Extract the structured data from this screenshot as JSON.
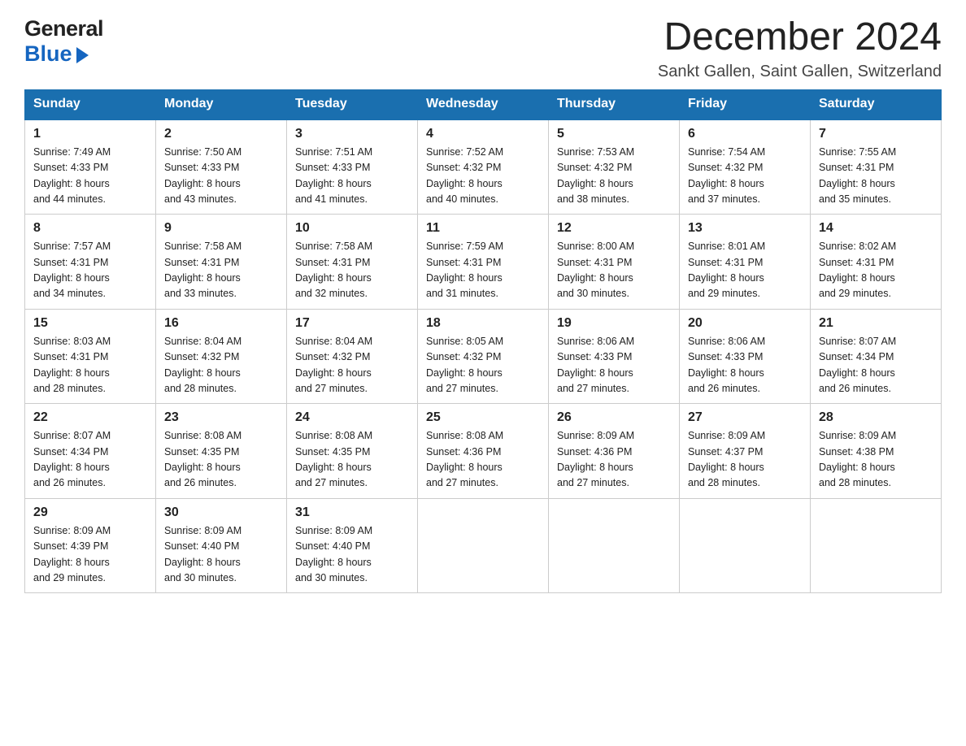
{
  "logo": {
    "general": "General",
    "blue": "Blue"
  },
  "header": {
    "month_title": "December 2024",
    "location": "Sankt Gallen, Saint Gallen, Switzerland"
  },
  "weekdays": [
    "Sunday",
    "Monday",
    "Tuesday",
    "Wednesday",
    "Thursday",
    "Friday",
    "Saturday"
  ],
  "weeks": [
    [
      {
        "day": "1",
        "sunrise": "7:49 AM",
        "sunset": "4:33 PM",
        "daylight": "8 hours and 44 minutes."
      },
      {
        "day": "2",
        "sunrise": "7:50 AM",
        "sunset": "4:33 PM",
        "daylight": "8 hours and 43 minutes."
      },
      {
        "day": "3",
        "sunrise": "7:51 AM",
        "sunset": "4:33 PM",
        "daylight": "8 hours and 41 minutes."
      },
      {
        "day": "4",
        "sunrise": "7:52 AM",
        "sunset": "4:32 PM",
        "daylight": "8 hours and 40 minutes."
      },
      {
        "day": "5",
        "sunrise": "7:53 AM",
        "sunset": "4:32 PM",
        "daylight": "8 hours and 38 minutes."
      },
      {
        "day": "6",
        "sunrise": "7:54 AM",
        "sunset": "4:32 PM",
        "daylight": "8 hours and 37 minutes."
      },
      {
        "day": "7",
        "sunrise": "7:55 AM",
        "sunset": "4:31 PM",
        "daylight": "8 hours and 35 minutes."
      }
    ],
    [
      {
        "day": "8",
        "sunrise": "7:57 AM",
        "sunset": "4:31 PM",
        "daylight": "8 hours and 34 minutes."
      },
      {
        "day": "9",
        "sunrise": "7:58 AM",
        "sunset": "4:31 PM",
        "daylight": "8 hours and 33 minutes."
      },
      {
        "day": "10",
        "sunrise": "7:58 AM",
        "sunset": "4:31 PM",
        "daylight": "8 hours and 32 minutes."
      },
      {
        "day": "11",
        "sunrise": "7:59 AM",
        "sunset": "4:31 PM",
        "daylight": "8 hours and 31 minutes."
      },
      {
        "day": "12",
        "sunrise": "8:00 AM",
        "sunset": "4:31 PM",
        "daylight": "8 hours and 30 minutes."
      },
      {
        "day": "13",
        "sunrise": "8:01 AM",
        "sunset": "4:31 PM",
        "daylight": "8 hours and 29 minutes."
      },
      {
        "day": "14",
        "sunrise": "8:02 AM",
        "sunset": "4:31 PM",
        "daylight": "8 hours and 29 minutes."
      }
    ],
    [
      {
        "day": "15",
        "sunrise": "8:03 AM",
        "sunset": "4:31 PM",
        "daylight": "8 hours and 28 minutes."
      },
      {
        "day": "16",
        "sunrise": "8:04 AM",
        "sunset": "4:32 PM",
        "daylight": "8 hours and 28 minutes."
      },
      {
        "day": "17",
        "sunrise": "8:04 AM",
        "sunset": "4:32 PM",
        "daylight": "8 hours and 27 minutes."
      },
      {
        "day": "18",
        "sunrise": "8:05 AM",
        "sunset": "4:32 PM",
        "daylight": "8 hours and 27 minutes."
      },
      {
        "day": "19",
        "sunrise": "8:06 AM",
        "sunset": "4:33 PM",
        "daylight": "8 hours and 27 minutes."
      },
      {
        "day": "20",
        "sunrise": "8:06 AM",
        "sunset": "4:33 PM",
        "daylight": "8 hours and 26 minutes."
      },
      {
        "day": "21",
        "sunrise": "8:07 AM",
        "sunset": "4:34 PM",
        "daylight": "8 hours and 26 minutes."
      }
    ],
    [
      {
        "day": "22",
        "sunrise": "8:07 AM",
        "sunset": "4:34 PM",
        "daylight": "8 hours and 26 minutes."
      },
      {
        "day": "23",
        "sunrise": "8:08 AM",
        "sunset": "4:35 PM",
        "daylight": "8 hours and 26 minutes."
      },
      {
        "day": "24",
        "sunrise": "8:08 AM",
        "sunset": "4:35 PM",
        "daylight": "8 hours and 27 minutes."
      },
      {
        "day": "25",
        "sunrise": "8:08 AM",
        "sunset": "4:36 PM",
        "daylight": "8 hours and 27 minutes."
      },
      {
        "day": "26",
        "sunrise": "8:09 AM",
        "sunset": "4:36 PM",
        "daylight": "8 hours and 27 minutes."
      },
      {
        "day": "27",
        "sunrise": "8:09 AM",
        "sunset": "4:37 PM",
        "daylight": "8 hours and 28 minutes."
      },
      {
        "day": "28",
        "sunrise": "8:09 AM",
        "sunset": "4:38 PM",
        "daylight": "8 hours and 28 minutes."
      }
    ],
    [
      {
        "day": "29",
        "sunrise": "8:09 AM",
        "sunset": "4:39 PM",
        "daylight": "8 hours and 29 minutes."
      },
      {
        "day": "30",
        "sunrise": "8:09 AM",
        "sunset": "4:40 PM",
        "daylight": "8 hours and 30 minutes."
      },
      {
        "day": "31",
        "sunrise": "8:09 AM",
        "sunset": "4:40 PM",
        "daylight": "8 hours and 30 minutes."
      },
      null,
      null,
      null,
      null
    ]
  ],
  "labels": {
    "sunrise_prefix": "Sunrise: ",
    "sunset_prefix": "Sunset: ",
    "daylight_prefix": "Daylight: "
  }
}
